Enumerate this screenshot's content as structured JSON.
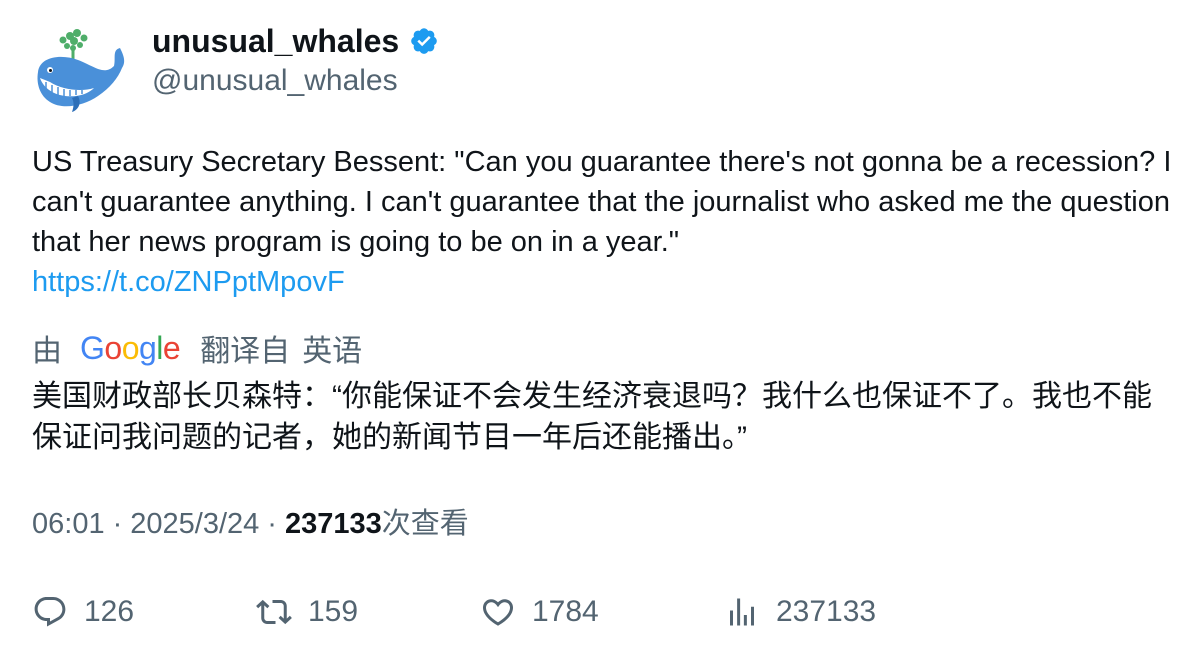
{
  "author": {
    "display_name": "unusual_whales",
    "handle": "@unusual_whales",
    "verified": true
  },
  "tweet": {
    "text": "US Treasury Secretary Bessent: \"Can you guarantee there's not gonna be a recession? I can't guarantee anything. I can't guarantee that the journalist who asked me the question that her news program is going to be on in a year.\"",
    "link": "https://t.co/ZNPptMpovF"
  },
  "translation": {
    "by_label": "由",
    "provider": "Google",
    "from_label": "翻译自",
    "language": "英语",
    "text": "美国财政部长贝森特：“你能保证不会发生经济衰退吗？我什么也保证不了。我也不能保证问我问题的记者，她的新闻节目一年后还能播出。”"
  },
  "meta": {
    "time": "06:01",
    "separator": "·",
    "date": "2025/3/24",
    "views": "237133",
    "views_label": "次查看"
  },
  "actions": {
    "replies": "126",
    "retweets": "159",
    "likes": "1784",
    "views": "237133"
  },
  "colors": {
    "text": "#0f1419",
    "secondary": "#536471",
    "link": "#1d9bf0",
    "verified": "#1d9bf0"
  },
  "icons": {
    "avatar": "whale-avatar",
    "verified": "verified-badge-icon",
    "reply": "reply-icon",
    "retweet": "retweet-icon",
    "like": "heart-icon",
    "views": "bar-chart-icon"
  }
}
